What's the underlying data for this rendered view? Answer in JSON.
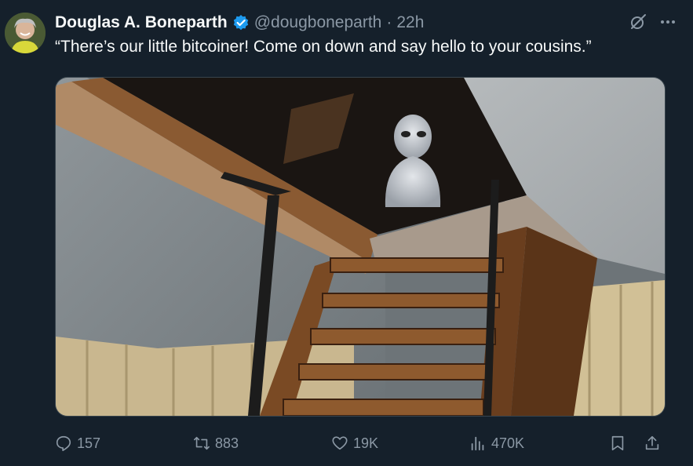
{
  "author": {
    "name": "Douglas A. Boneparth",
    "handle": "@dougboneparth",
    "separator": "·",
    "time": "22h"
  },
  "tweet": {
    "text": "“There’s our little bitcoiner! Come on down and say hello to your cousins.”"
  },
  "actions": {
    "replies": "157",
    "retweets": "883",
    "likes": "19K",
    "views": "470K"
  },
  "colors": {
    "background": "#15202b",
    "text": "#f7f9f9",
    "muted": "#8b98a5",
    "verified": "#1d9bf0"
  },
  "icons": {
    "grok": "grok-icon",
    "more": "more-icon",
    "reply": "reply-icon",
    "retweet": "retweet-icon",
    "like": "heart-icon",
    "views": "views-icon",
    "bookmark": "bookmark-icon",
    "share": "share-icon"
  }
}
